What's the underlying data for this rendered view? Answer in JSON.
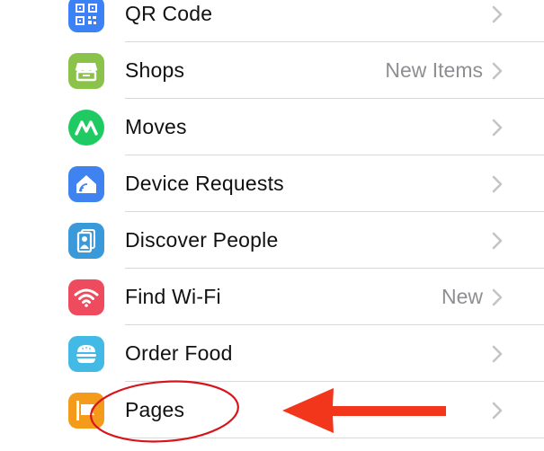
{
  "settings_list": {
    "items": [
      {
        "label": "QR Code",
        "detail": "",
        "icon": "qr-code-icon",
        "color": "#3b82f6"
      },
      {
        "label": "Shops",
        "detail": "New Items",
        "icon": "shop-icon",
        "color": "#8bc34a"
      },
      {
        "label": "Moves",
        "detail": "",
        "icon": "moves-icon",
        "color": "#1fca63"
      },
      {
        "label": "Device Requests",
        "detail": "",
        "icon": "device-requests-icon",
        "color": "#3e83f0"
      },
      {
        "label": "Discover People",
        "detail": "",
        "icon": "discover-people-icon",
        "color": "#3a9ad9"
      },
      {
        "label": "Find Wi-Fi",
        "detail": "New",
        "icon": "wifi-icon",
        "color": "#ef4b5f"
      },
      {
        "label": "Order Food",
        "detail": "",
        "icon": "order-food-icon",
        "color": "#43b9e6"
      },
      {
        "label": "Pages",
        "detail": "",
        "icon": "pages-icon",
        "color": "#f59b1b"
      }
    ]
  },
  "annotation": {
    "highlight_color": "#d7141a",
    "arrow_color": "#f2361c"
  }
}
